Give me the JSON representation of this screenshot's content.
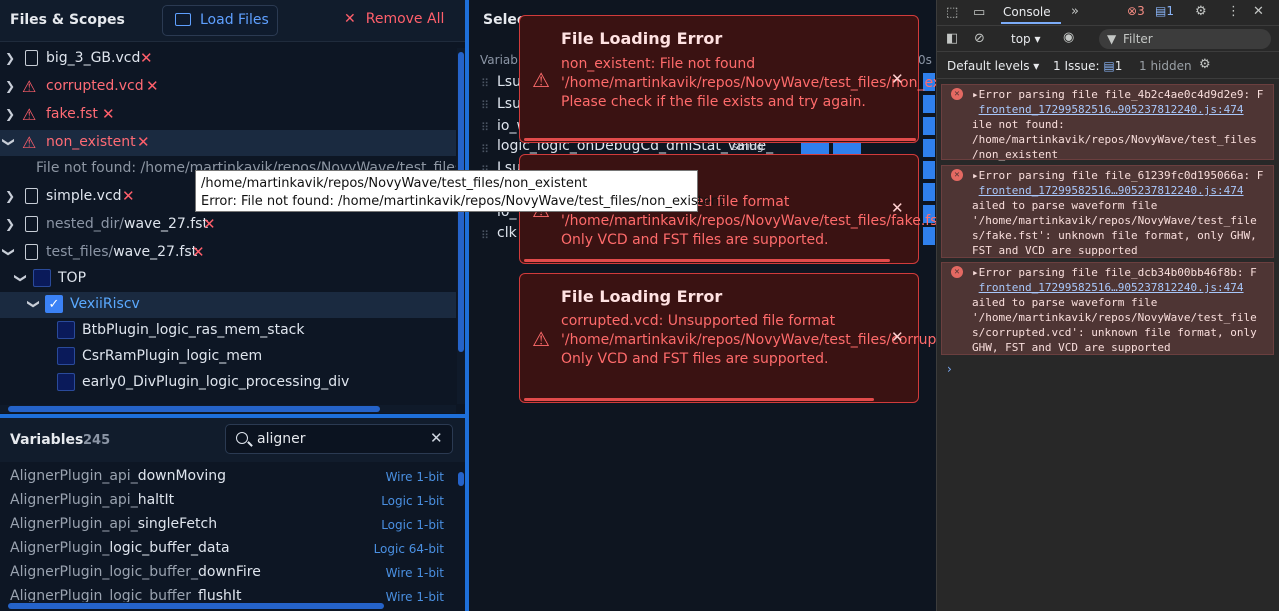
{
  "files_panel": {
    "title": "Files & Scopes",
    "load_button": "Load Files",
    "remove_button": "Remove All",
    "files": [
      {
        "name": "big_3_GB.vcd",
        "state": "ok"
      },
      {
        "name": "corrupted.vcd",
        "state": "error"
      },
      {
        "name": "fake.fst",
        "state": "error"
      },
      {
        "name": "non_existent",
        "state": "error",
        "expanded": true,
        "error_line": "File not found: /home/martinkavik/repos/NovyWave/test_files/no"
      },
      {
        "name": "simple.vcd",
        "state": "ok"
      },
      {
        "prefix": "nested_dir/",
        "name": "wave_27.fst",
        "state": "ok"
      },
      {
        "prefix": "test_files/",
        "name": "wave_27.fst",
        "state": "ok",
        "expanded": true
      }
    ],
    "scopes": [
      {
        "name": "TOP",
        "checked": false
      },
      {
        "name": "VexiiRiscv",
        "checked": true
      },
      {
        "name": "BtbPlugin_logic_ras_mem_stack",
        "checked": false
      },
      {
        "name": "CsrRamPlugin_logic_mem",
        "checked": false
      },
      {
        "name": "early0_DivPlugin_logic_processing_div",
        "checked": false
      }
    ]
  },
  "tooltip": {
    "line1": "/home/martinkavik/repos/NovyWave/test_files/non_existent",
    "line2": "Error: File not found: /home/martinkavik/repos/NovyWave/test_files/non_existent"
  },
  "variables_panel": {
    "title": "Variables",
    "count": "245",
    "search_value": "aligner",
    "rows": [
      {
        "prefix": "AlignerPlugin_api_",
        "name": "downMoving",
        "type": "Wire 1-bit"
      },
      {
        "prefix": "AlignerPlugin_api_",
        "name": "haltIt",
        "type": "Logic 1-bit"
      },
      {
        "prefix": "AlignerPlugin_api_",
        "name": "singleFetch",
        "type": "Logic 1-bit"
      },
      {
        "prefix": "AlignerPlugin_",
        "name": "logic_buffer_data",
        "type": "Logic 64-bit"
      },
      {
        "prefix": "AlignerPlugin_logic_buffer_",
        "name": "downFire",
        "type": "Wire 1-bit"
      },
      {
        "prefix": "AlignerPlugin_logic_buffer_",
        "name": "flushIt",
        "type": "Wire 1-bit"
      }
    ]
  },
  "selected_panel": {
    "title": "Selec",
    "sub": "Variabl",
    "names": [
      "Lsu",
      "Lsu",
      "io_w",
      "logic_logic_onDebugCd_dmiStat_value_",
      "Lsu",
      "",
      "io_",
      "clk"
    ],
    "overlap_text": "0s",
    "overlap_label": "string"
  },
  "toasts": [
    {
      "title": "File Loading Error",
      "message": "non_existent: File not found '/home/martinkavik/repos/NovyWave/test_files/non_existent'. Please check if the file exists and try again."
    },
    {
      "title": "File Loading Error",
      "message": "fake.fst: Unsupported file format '/home/martinkavik/repos/NovyWave/test_files/fake.fst'. Only VCD and FST files are supported."
    },
    {
      "title": "File Loading Error",
      "message": "corrupted.vcd: Unsupported file format '/home/martinkavik/repos/NovyWave/test_files/corrupted.vcd'. Only VCD and FST files are supported."
    }
  ],
  "devtools": {
    "tab": "Console",
    "error_count": "3",
    "message_count": "1",
    "context": "top",
    "filter_placeholder": "Filter",
    "levels": "Default levels",
    "issues": "1 Issue:",
    "issues_count": "1",
    "hidden": "1 hidden",
    "errors": [
      {
        "head": "Error parsing file file_4b2c4ae0c4d9d2e9: F",
        "link": "frontend_17299582516…905237812240.js:474",
        "tail": "ile not found: /home/martinkavik/repos/NovyWave/test_files /non_existent"
      },
      {
        "head": "Error parsing file file_61239fc0d195066a: F",
        "link": "frontend_17299582516…905237812240.js:474",
        "tail": "ailed to parse waveform file '/home/martinkavik/repos/NovyWave/test_file s/fake.fst': unknown file format, only GHW, FST and VCD are supported"
      },
      {
        "head": "Error parsing file file_dcb34b00bb46f8b: F",
        "link": "frontend_17299582516…905237812240.js:474",
        "tail": "ailed to parse waveform file '/home/martinkavik/repos/NovyWave/test_file s/corrupted.vcd': unknown file format, only GHW, FST and VCD are supported"
      }
    ]
  }
}
